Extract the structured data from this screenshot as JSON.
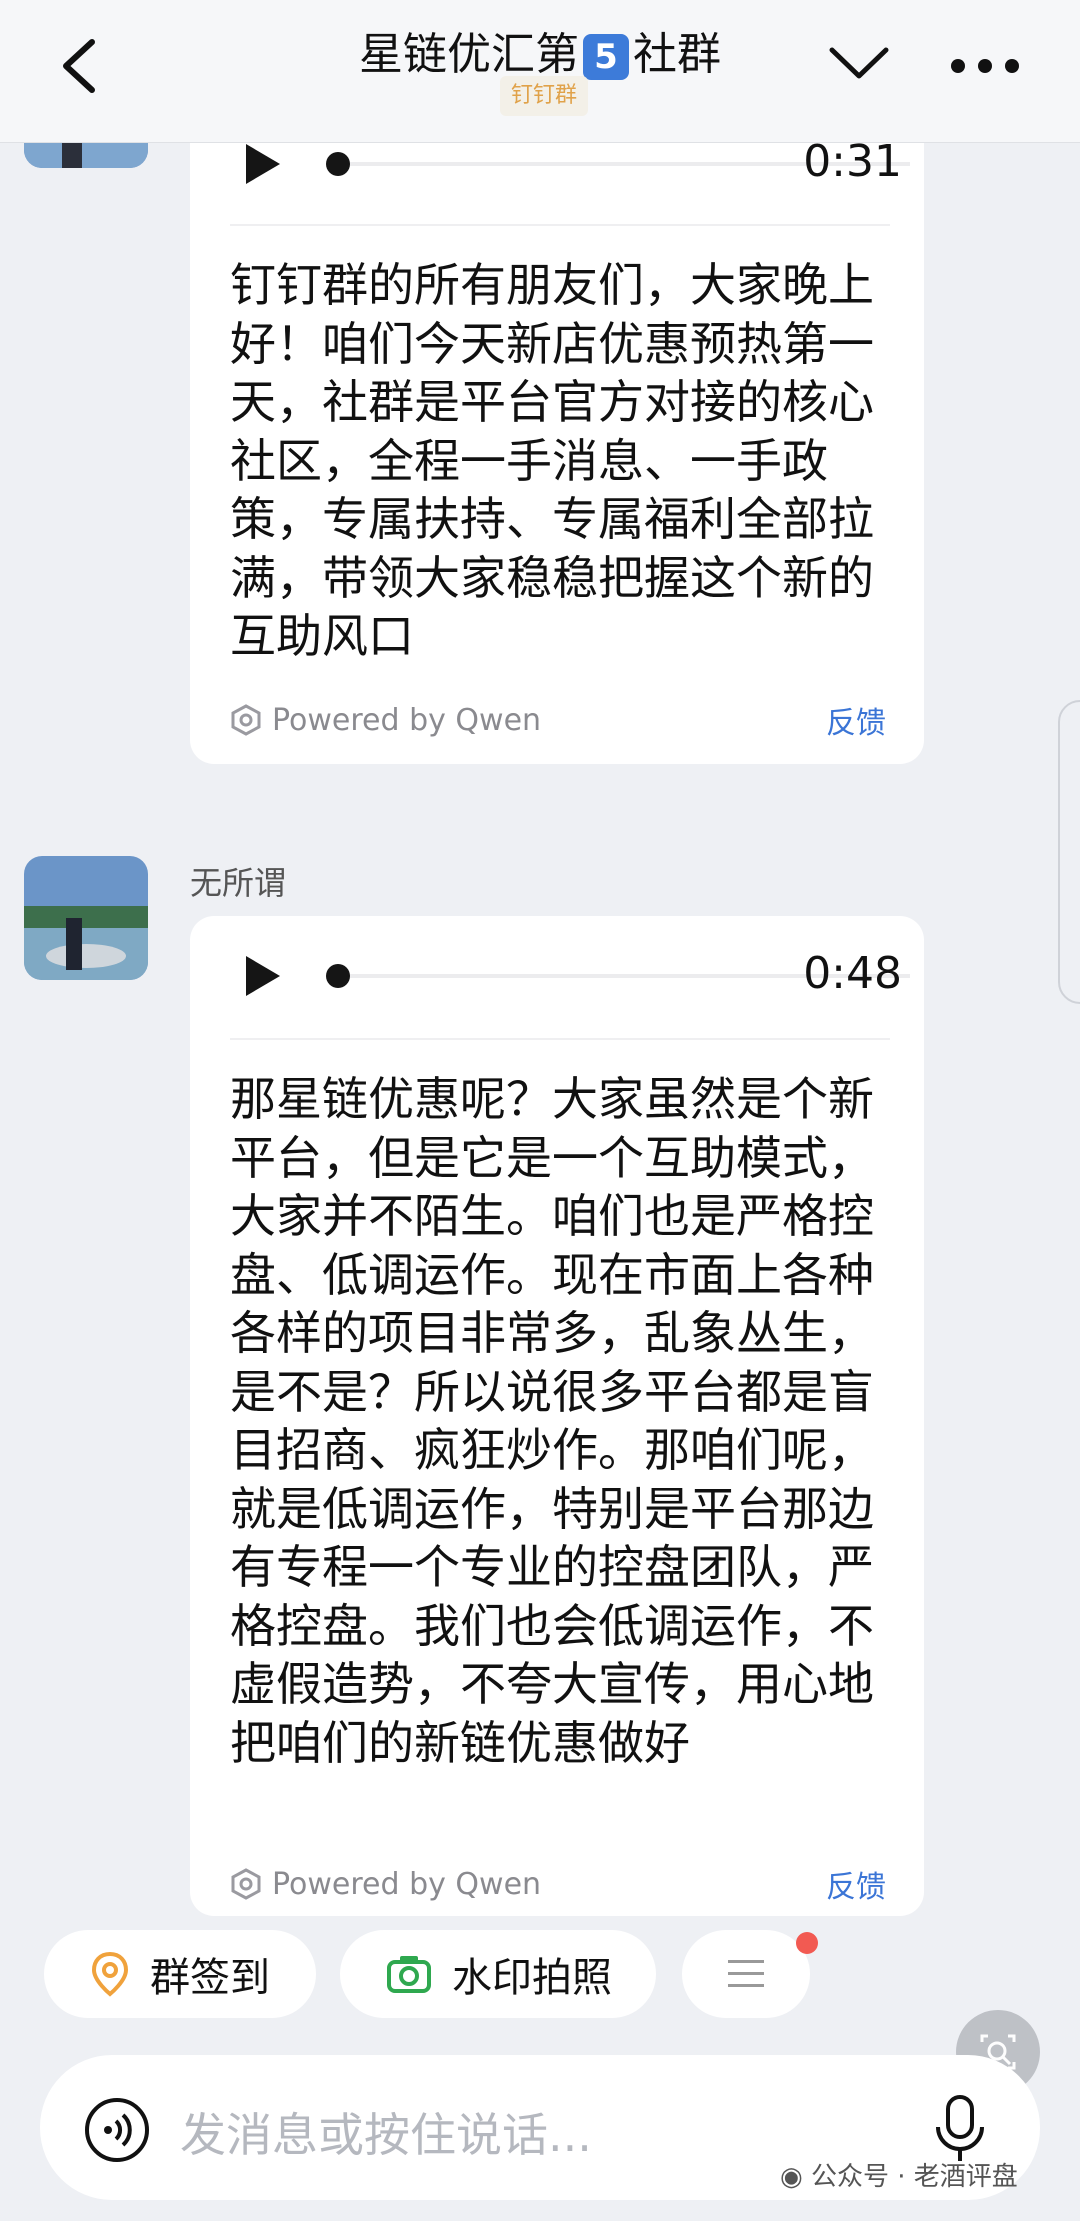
{
  "header": {
    "title_prefix": "星链优汇第",
    "title_number": "5",
    "title_suffix": "社群",
    "tag": "钉钉群"
  },
  "messages": [
    {
      "duration": "0:31",
      "text": "钉钉群的所有朋友们，大家晚上好！咱们今天新店优惠预热第一天，社群是平台官方对接的核心社区，全程一手消息、一手政策，专属扶持、专属福利全部拉满，带领大家稳稳把握这个新的互助风口",
      "powered": "Powered by Qwen",
      "feedback": "反馈"
    },
    {
      "sender": "无所谓",
      "duration": "0:48",
      "text": "那星链优惠呢？大家虽然是个新平台，但是它是一个互助模式，大家并不陌生。咱们也是严格控盘、低调运作。现在市面上各种各样的项目非常多，乱象丛生，是不是？所以说很多平台都是盲目招商、疯狂炒作。那咱们呢，就是低调运作，特别是平台那边有专程一个专业的控盘团队，严格控盘。我们也会低调运作，不虚假造势，不夸大宣传，用心地把咱们的新链优惠做好",
      "powered": "Powered by Qwen",
      "feedback": "反馈"
    }
  ],
  "quick_actions": [
    {
      "label": "群签到",
      "icon": "location-pin-icon"
    },
    {
      "label": "水印拍照",
      "icon": "camera-icon"
    },
    {
      "label": "",
      "icon": "menu-icon"
    }
  ],
  "input": {
    "placeholder": "发消息或按住说话..."
  },
  "watermark": "公众号 · 老酒评盘",
  "colors": {
    "accent_blue": "#3b75d6",
    "badge_blue": "#3d7bd9",
    "pin_orange": "#f0a23c",
    "camera_green": "#2fa84f",
    "notify_red": "#f25a52"
  }
}
